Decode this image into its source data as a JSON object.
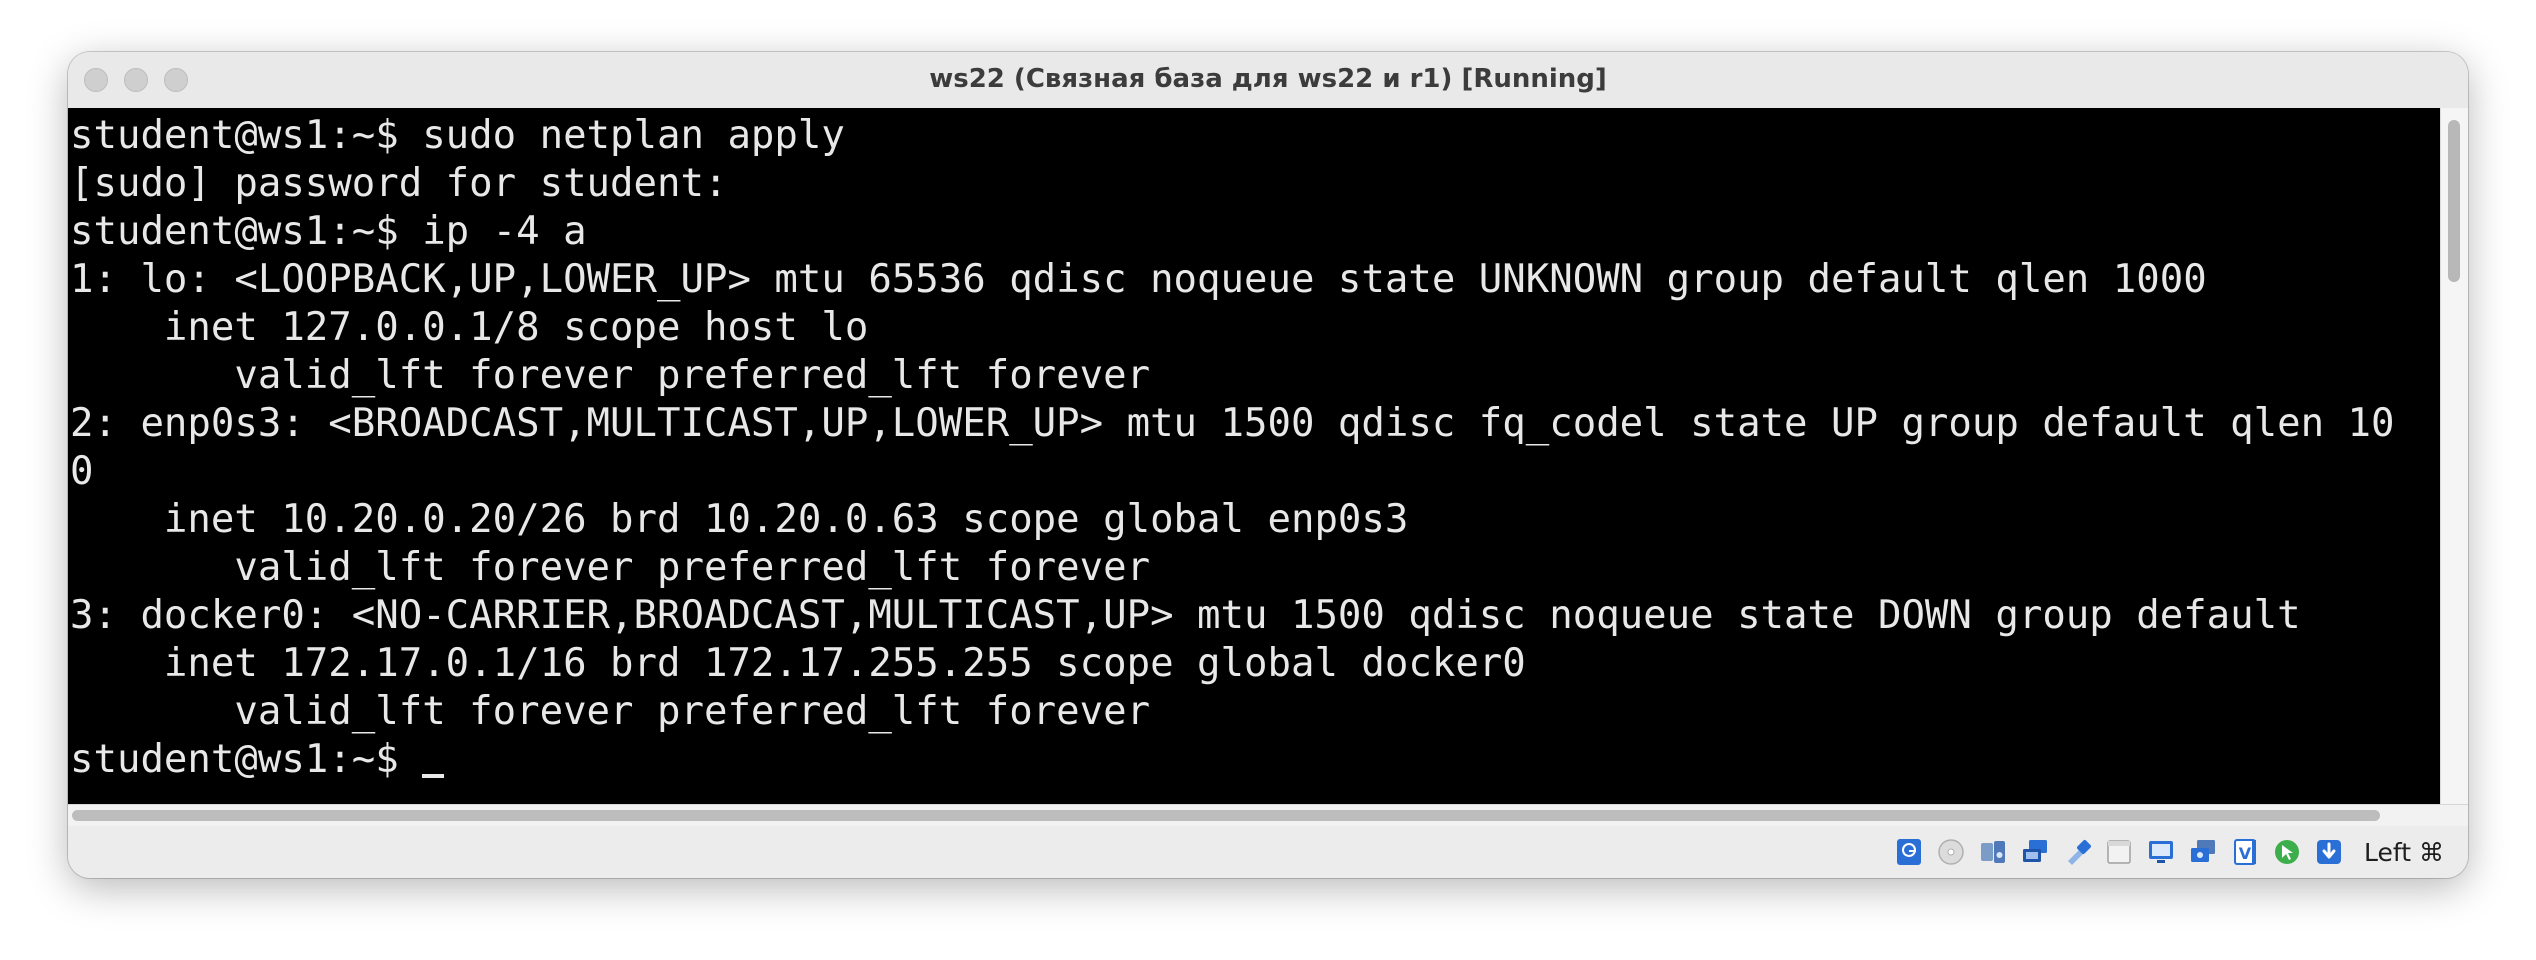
{
  "window": {
    "title": "ws22 (Связная база для ws22 и r1) [Running]"
  },
  "terminal": {
    "lines": [
      "student@ws1:~$ sudo netplan apply",
      "[sudo] password for student:",
      "student@ws1:~$ ip -4 a",
      "1: lo: <LOOPBACK,UP,LOWER_UP> mtu 65536 qdisc noqueue state UNKNOWN group default qlen 1000",
      "    inet 127.0.0.1/8 scope host lo",
      "       valid_lft forever preferred_lft forever",
      "2: enp0s3: <BROADCAST,MULTICAST,UP,LOWER_UP> mtu 1500 qdisc fq_codel state UP group default qlen 10",
      "0",
      "    inet 10.20.0.20/26 brd 10.20.0.63 scope global enp0s3",
      "       valid_lft forever preferred_lft forever",
      "3: docker0: <NO-CARRIER,BROADCAST,MULTICAST,UP> mtu 1500 qdisc noqueue state DOWN group default",
      "    inet 172.17.0.1/16 brd 172.17.255.255 scope global docker0",
      "       valid_lft forever preferred_lft forever"
    ],
    "prompt": "student@ws1:~$ "
  },
  "statusbar": {
    "icons": [
      "hard-disk-icon",
      "optical-drive-icon",
      "audio-icon",
      "network-icon",
      "usb-icon",
      "shared-folders-icon",
      "display-icon",
      "recording-icon",
      "cpu-virtualization-icon",
      "mouse-integration-icon",
      "keyboard-capture-icon"
    ],
    "host_key": "Left ⌘"
  },
  "colors": {
    "terminal_bg": "#000000",
    "terminal_fg": "#e8e8e8",
    "chrome_bg": "#ececec",
    "icon_blue": "#2a6fd6"
  }
}
